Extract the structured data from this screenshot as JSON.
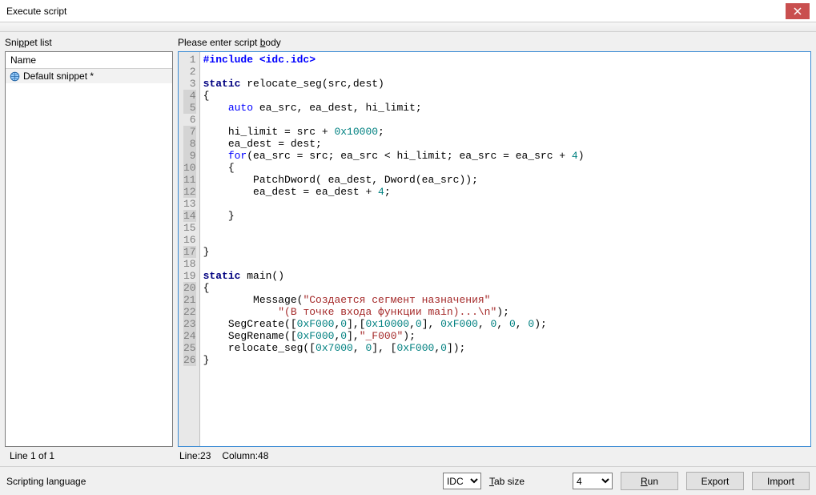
{
  "window": {
    "title": "Execute script"
  },
  "left": {
    "label_prefix": "Sni",
    "label_underlined": "p",
    "label_suffix": "pet list",
    "header": "Name",
    "item": "Default snippet *",
    "status": "Line 1 of 1"
  },
  "right": {
    "label_prefix": "Please enter script ",
    "label_underlined": "b",
    "label_suffix": "ody",
    "status_line": "Line:23",
    "status_col": "Column:48"
  },
  "bottom": {
    "label": "Scripting language",
    "lang_value": "IDC",
    "tab_label_underlined": "T",
    "tab_label_suffix": "ab size",
    "tab_value": "4",
    "run": "Run",
    "export": "Export",
    "import": "Import"
  },
  "code": {
    "lines": [
      {
        "n": 1,
        "html": "<span class='kw-pre'>#include &lt;idc.idc&gt;</span>"
      },
      {
        "n": 2,
        "html": ""
      },
      {
        "n": 3,
        "html": "<span class='kw-static'>static</span> relocate_seg(src,dest)"
      },
      {
        "n": 4,
        "html": "{"
      },
      {
        "n": 5,
        "html": "    <span class='kw-blue'>auto</span> ea_src, ea_dest, hi_limit;"
      },
      {
        "n": 6,
        "html": ""
      },
      {
        "n": 7,
        "html": "    hi_limit = src + <span class='num'>0x10000</span>;"
      },
      {
        "n": 8,
        "html": "    ea_dest = dest;"
      },
      {
        "n": 9,
        "html": "    <span class='kw-blue'>for</span>(ea_src = src; ea_src &lt; hi_limit; ea_src = ea_src + <span class='num'>4</span>)"
      },
      {
        "n": 10,
        "html": "    {"
      },
      {
        "n": 11,
        "html": "        PatchDword( ea_dest, Dword(ea_src));"
      },
      {
        "n": 12,
        "html": "        ea_dest = ea_dest + <span class='num'>4</span>;"
      },
      {
        "n": 13,
        "html": ""
      },
      {
        "n": 14,
        "html": "    }"
      },
      {
        "n": 15,
        "html": ""
      },
      {
        "n": 16,
        "html": ""
      },
      {
        "n": 17,
        "html": "}"
      },
      {
        "n": 18,
        "html": ""
      },
      {
        "n": 19,
        "html": "<span class='kw-static'>static</span> main()"
      },
      {
        "n": 20,
        "html": "{"
      },
      {
        "n": 21,
        "html": "        Message(<span class='str'>\"Создается сегмент назначения\"</span>"
      },
      {
        "n": 22,
        "html": "            <span class='str'>\"(В точке входа функции main)...\\n\"</span>);"
      },
      {
        "n": 23,
        "html": "    SegCreate([<span class='num'>0xF000</span>,<span class='num'>0</span>],[<span class='num'>0x10000</span>,<span class='num'>0</span>], <span class='num'>0xF000</span>, <span class='num'>0</span>, <span class='num'>0</span>, <span class='num'>0</span>);"
      },
      {
        "n": 24,
        "html": "    SegRename([<span class='num'>0xF000</span>,<span class='num'>0</span>],<span class='str'>\"_F000\"</span>);"
      },
      {
        "n": 25,
        "html": "    relocate_seg([<span class='num'>0x7000</span>, <span class='num'>0</span>], [<span class='num'>0xF000</span>,<span class='num'>0</span>]);"
      },
      {
        "n": 26,
        "html": "}"
      }
    ],
    "highlighted": [
      4,
      5,
      7,
      8,
      9,
      10,
      11,
      12,
      14,
      17,
      20,
      21,
      22,
      23,
      24,
      25,
      26
    ]
  }
}
